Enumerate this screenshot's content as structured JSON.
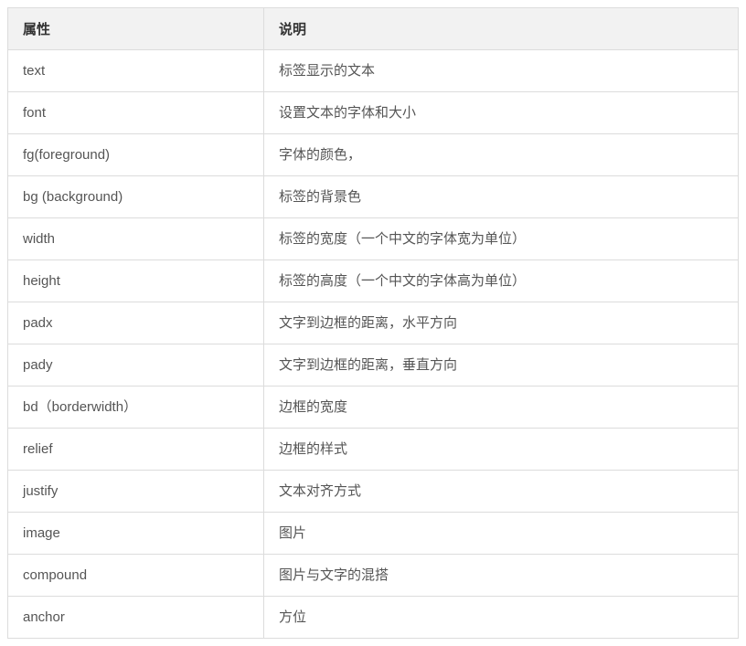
{
  "table": {
    "headers": {
      "attribute": "属性",
      "description": "说明"
    },
    "rows": [
      {
        "attr": "text",
        "desc": "标签显示的文本"
      },
      {
        "attr": "font",
        "desc": "设置文本的字体和大小"
      },
      {
        "attr": "fg(foreground)",
        "desc": "字体的颜色，"
      },
      {
        "attr": "bg (background)",
        "desc": "标签的背景色"
      },
      {
        "attr": "width",
        "desc": "标签的宽度（一个中文的字体宽为单位）"
      },
      {
        "attr": "height",
        "desc": "标签的高度（一个中文的字体高为单位）"
      },
      {
        "attr": "padx",
        "desc": "文字到边框的距离，水平方向"
      },
      {
        "attr": "pady",
        "desc": "文字到边框的距离，垂直方向"
      },
      {
        "attr": "bd（borderwidth）",
        "desc": "边框的宽度"
      },
      {
        "attr": "relief",
        "desc": "边框的样式"
      },
      {
        "attr": "justify",
        "desc": "文本对齐方式"
      },
      {
        "attr": "image",
        "desc": "图片"
      },
      {
        "attr": "compound",
        "desc": "图片与文字的混搭"
      },
      {
        "attr": "anchor",
        "desc": "方位"
      }
    ]
  }
}
